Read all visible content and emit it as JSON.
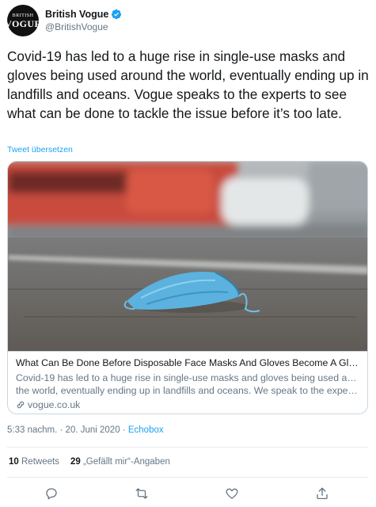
{
  "account": {
    "avatar_top": "BRITISH",
    "avatar_bottom": "VOGUE",
    "display_name": "British Vogue",
    "handle": "@BritishVogue"
  },
  "tweet": {
    "text": "Covid-19 has led to a huge rise in single-use masks and gloves being used around the world, eventually ending up in landfills and oceans. Vogue speaks to the experts to see what can be done to tackle the issue before it’s too late.",
    "translate_label": "Tweet übersetzen"
  },
  "card": {
    "title": "What Can Be Done Before Disposable Face Masks And Gloves Become A Global ...",
    "desc_line1": "Covid-19 has led to a huge rise in single-use masks and gloves being used around",
    "desc_line2": "the world, eventually ending up in landfills and oceans. We speak to the experts t...",
    "domain": "vogue.co.uk"
  },
  "meta": {
    "time": "5:33 nachm.",
    "separator": "·",
    "date": "20. Juni 2020",
    "source": "Echobox"
  },
  "stats": {
    "retweets_count": "10",
    "retweets_label": "Retweets",
    "likes_count": "29",
    "likes_label": "„Gefällt mir“-Angaben"
  },
  "icons": {
    "verified": "verified-badge-icon",
    "link": "link-icon",
    "reply": "reply-icon",
    "retweet": "retweet-icon",
    "like": "heart-icon",
    "share": "share-icon"
  },
  "colors": {
    "accent": "#1da1f2",
    "secondary_text": "#657786",
    "border": "#ccd6dd"
  }
}
